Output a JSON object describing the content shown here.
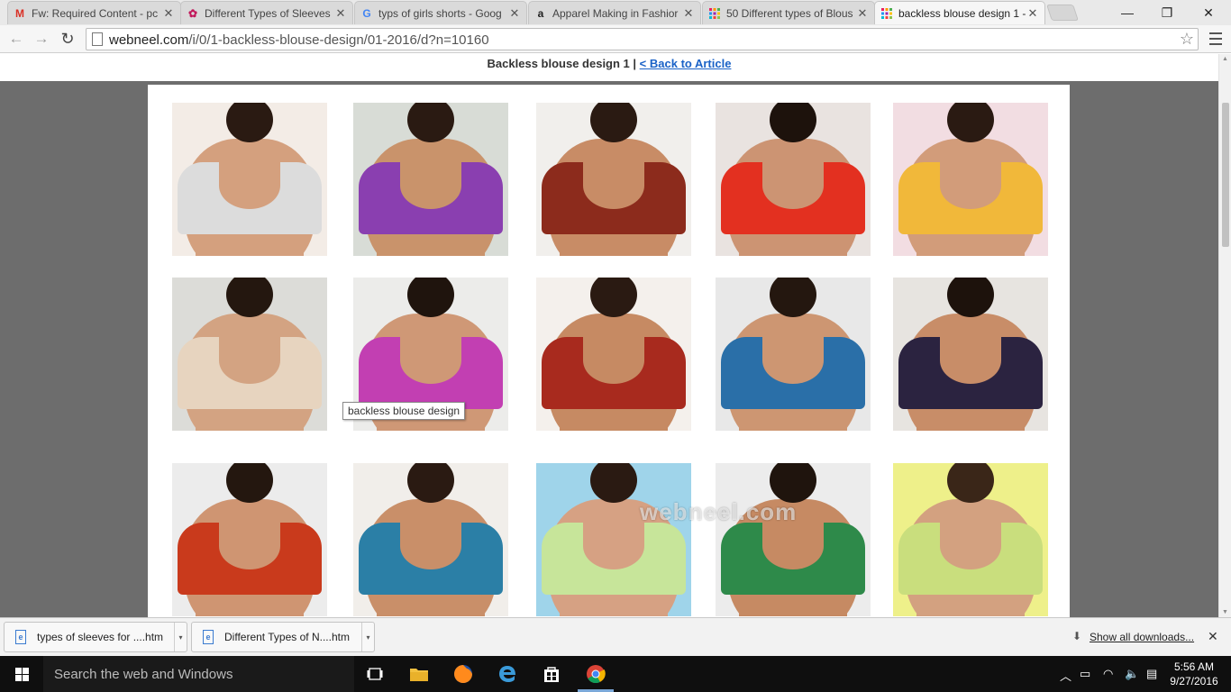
{
  "browser": {
    "tabs": [
      {
        "title": "Fw: Required Content - pc",
        "icon": "gmail-icon",
        "icon_color": "#d93025",
        "active": false
      },
      {
        "title": "Different Types of Sleeves",
        "icon": "sleeve-site-icon",
        "icon_color": "#c2185b",
        "active": false
      },
      {
        "title": "typs of girls shorts - Goog",
        "icon": "google-icon",
        "icon_color": "#4285f4",
        "active": false
      },
      {
        "title": "Apparel Making in Fashior",
        "icon": "amazon-icon",
        "icon_color": "#222222",
        "active": false
      },
      {
        "title": "50 Different types of Blous",
        "icon": "webneel-icon",
        "icon_color": "#e91e63",
        "active": false
      },
      {
        "title": "backless blouse design 1 -",
        "icon": "webneel-icon",
        "icon_color": "#e91e63",
        "active": true
      }
    ],
    "url_host": "webneel.com",
    "url_path": "/i/0/1-backless-blouse-design/01-2016/d?n=10160"
  },
  "page": {
    "caption_title": "Backless blouse design 1",
    "caption_separator": "|",
    "back_link": "< Back to Article",
    "tooltip": "backless blouse design",
    "watermark": "webneel.com",
    "gallery_alt": "backless blouse design",
    "gallery": [
      {
        "bg": "#f3ece6",
        "skin": "#d4a07e",
        "blouse": "#dcdcdc",
        "hair": "#2a1a12"
      },
      {
        "bg": "#d8dcd6",
        "skin": "#c9936b",
        "blouse": "#8a3fb0",
        "hair": "#2a1a12"
      },
      {
        "bg": "#f1efec",
        "skin": "#c88c66",
        "blouse": "#8c2b1c",
        "hair": "#2a1a12"
      },
      {
        "bg": "#e9e3e0",
        "skin": "#cc9473",
        "blouse": "#e33020",
        "hair": "#1d120c"
      },
      {
        "bg": "#f2dde2",
        "skin": "#d29c7a",
        "blouse": "#f1b83a",
        "hair": "#2a1a12"
      },
      {
        "bg": "#dcdcd8",
        "skin": "#d3a382",
        "blouse": "#e7d4bf",
        "hair": "#24170f"
      },
      {
        "bg": "#ececea",
        "skin": "#cf9876",
        "blouse": "#c23fb2",
        "hair": "#1f140d"
      },
      {
        "bg": "#f4f0ec",
        "skin": "#c68a63",
        "blouse": "#a82a1e",
        "hair": "#2a1a12"
      },
      {
        "bg": "#e8e8e8",
        "skin": "#cd9672",
        "blouse": "#2a6fa8",
        "hair": "#24170f"
      },
      {
        "bg": "#e7e4e0",
        "skin": "#c88d68",
        "blouse": "#2b2340",
        "hair": "#1d120c"
      },
      {
        "bg": "#ececec",
        "skin": "#cf9572",
        "blouse": "#c93a1c",
        "hair": "#24170f"
      },
      {
        "bg": "#f1eeea",
        "skin": "#c98f69",
        "blouse": "#2b7fa6",
        "hair": "#2a1a12"
      },
      {
        "bg": "#9fd4ea",
        "skin": "#d6a183",
        "blouse": "#c7e59a",
        "hair": "#2a1a12"
      },
      {
        "bg": "#ececec",
        "skin": "#c68a63",
        "blouse": "#2e8a4a",
        "hair": "#1f140d"
      },
      {
        "bg": "#eef08a",
        "skin": "#d3a180",
        "blouse": "#c9de7d",
        "hair": "#3a2618"
      }
    ]
  },
  "downloads": {
    "items": [
      {
        "name": "types of sleeves for ....htm"
      },
      {
        "name": "Different Types of N....htm"
      }
    ],
    "show_all": "Show all downloads..."
  },
  "taskbar": {
    "search_placeholder": "Search the web and Windows",
    "time": "5:56 AM",
    "date": "9/27/2016"
  }
}
